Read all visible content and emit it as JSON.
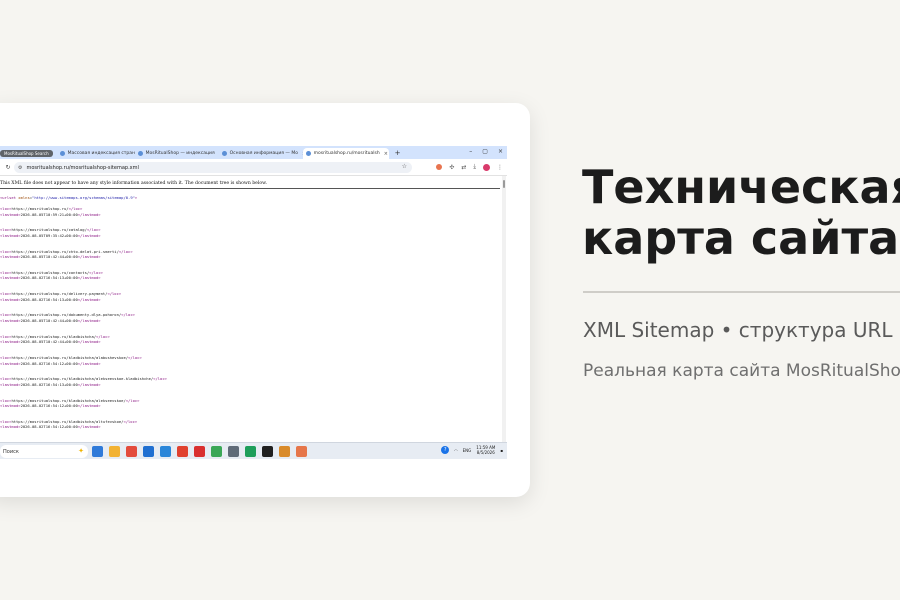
{
  "browser": {
    "tabs": [
      {
        "label": "MosRitualShop Search",
        "kind": "group"
      },
      {
        "label": "Массовая индексация страни"
      },
      {
        "label": "MosRitualShop — индексация"
      },
      {
        "label": "Основная информация — Mo"
      },
      {
        "label": "mosritualshop.ru/mosritualsh",
        "active": true
      }
    ],
    "new_tab": "+",
    "close": "×",
    "url": "mosritualshop.ru/mosritualshop-sitemap.xml"
  },
  "xml_viewer": {
    "info": "This XML file does not appear to have any style information associated with it. The document tree is shown below.",
    "urlset_tag": "<urlset ",
    "urlset_attr": "xmlns",
    "urlset_val": "\"http://www.sitemaps.org/schemas/sitemap/0.9\"",
    "urlset_close": ">",
    "entries": [
      {
        "loc": "https://mosritualshop.ru/",
        "lastmod": "2026-08-05T10:59:21+00:00"
      },
      {
        "loc": "https://mosritualshop.ru/catalog/",
        "lastmod": "2026-08-05T09:35:42+00:00"
      },
      {
        "loc": "https://mosritualshop.ru/chto-delat-pri-smerti/",
        "lastmod": "2026-08-05T10:42:44+00:00"
      },
      {
        "loc": "https://mosritualshop.ru/contacts/",
        "lastmod": "2026-08-02T16:54:13+00:00"
      },
      {
        "loc": "https://mosritualshop.ru/delivery-payment/",
        "lastmod": "2026-08-02T16:54:13+00:00"
      },
      {
        "loc": "https://mosritualshop.ru/dokumenty-dlya-pohoron/",
        "lastmod": "2026-08-05T10:42:44+00:00"
      },
      {
        "loc": "https://mosritualshop.ru/kladbishcha/",
        "lastmod": "2026-08-05T10:42:44+00:00"
      },
      {
        "loc": "https://mosritualshop.ru/kladbishcha/alabushevskoe/",
        "lastmod": "2026-08-02T16:54:12+00:00"
      },
      {
        "loc": "https://mosritualshop.ru/kladbishcha/alekseevskoe-kladbishche/",
        "lastmod": "2026-08-02T16:54:13+00:00"
      },
      {
        "loc": "https://mosritualshop.ru/kladbishcha/alekseevskoe/",
        "lastmod": "2026-08-02T16:54:12+00:00"
      },
      {
        "loc": "https://mosritualshop.ru/kladbishcha/altufevskoe/",
        "lastmod": "2026-08-02T16:54:12+00:00"
      }
    ]
  },
  "taskbar": {
    "search_label": "Поиск",
    "lang": "ENG",
    "time": "11:59 AM",
    "date": "8/5/2026",
    "app_colors": [
      "#2f7ad9",
      "#f2b233",
      "#e34b3c",
      "#1f6fd1",
      "#2a86d9",
      "#e0412f",
      "#d92f2f",
      "#3aa757",
      "#5f6b78",
      "#1e9e5a",
      "#202020",
      "#d98b2b",
      "#e6764a"
    ]
  },
  "panel": {
    "title_line1": "Техническая",
    "title_line2": "карта сайта",
    "subtitle": "XML Sitemap • структура URL",
    "caption": "Реальная карта сайта MosRitualShop"
  }
}
